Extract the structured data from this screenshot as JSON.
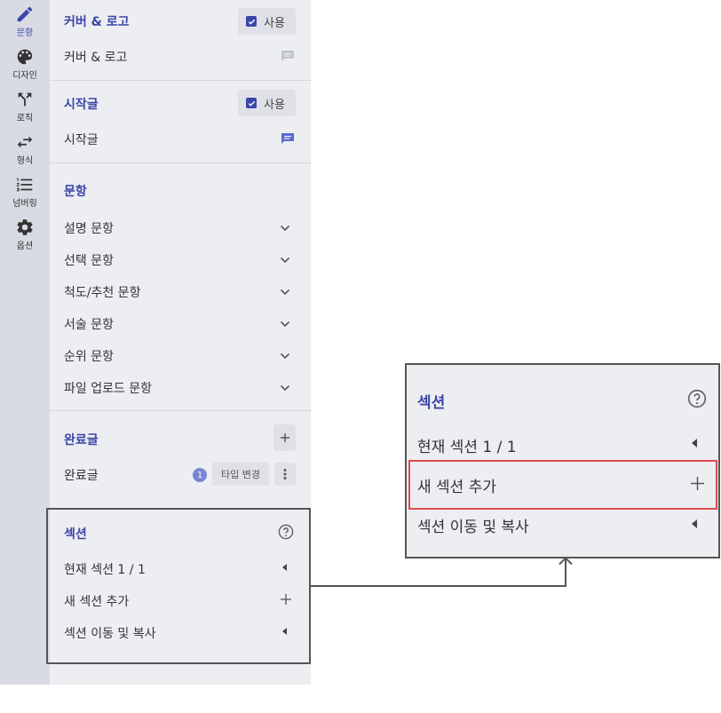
{
  "rail": [
    {
      "label": "문항",
      "icon": "pencil-icon",
      "active": true
    },
    {
      "label": "디자인",
      "icon": "palette-icon",
      "active": false
    },
    {
      "label": "로직",
      "icon": "branch-icon",
      "active": false
    },
    {
      "label": "형식",
      "icon": "swap-icon",
      "active": false
    },
    {
      "label": "넘버링",
      "icon": "numbered-list-icon",
      "active": false
    },
    {
      "label": "옵션",
      "icon": "gear-icon",
      "active": false
    }
  ],
  "cover": {
    "title": "커버 & 로고",
    "use_label": "사용",
    "item": "커버 & 로고"
  },
  "intro": {
    "title": "시작글",
    "use_label": "사용",
    "item": "시작글"
  },
  "questions": {
    "title": "문항",
    "items": [
      "설명 문항",
      "선택 문항",
      "척도/추천 문항",
      "서술 문항",
      "순위 문항",
      "파일 업로드 문항"
    ]
  },
  "completion": {
    "title": "완료글",
    "item": "완료글",
    "badge": "1",
    "type_change": "타입 변경"
  },
  "section": {
    "title": "섹션",
    "current": "현재 섹션 1 / 1",
    "add": "새 섹션 추가",
    "move_copy": "섹션 이동 및 복사"
  },
  "zoom": {
    "title": "섹션",
    "current": "현재 섹션 1 / 1",
    "add": "새 섹션 추가",
    "move_copy": "섹션 이동 및 복사"
  },
  "colors": {
    "accent": "#3c45a8",
    "highlight": "#e04a50",
    "rail_bg": "#d8dbe3",
    "panel_bg": "#eceef2"
  }
}
